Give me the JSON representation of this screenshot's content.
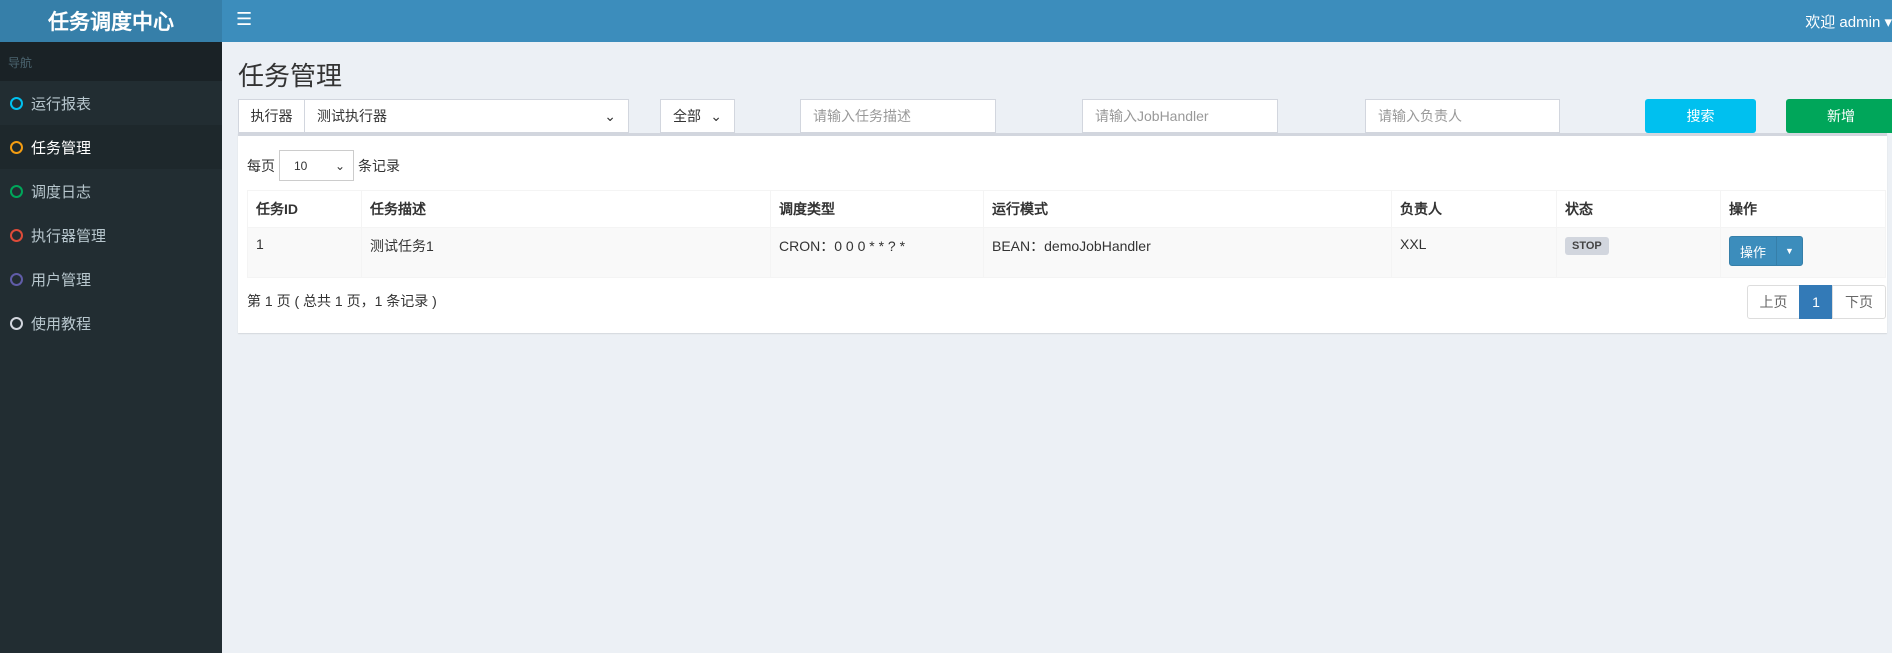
{
  "app": {
    "title": "任务调度中心",
    "welcome": "欢迎 admin"
  },
  "sidebar": {
    "header": "导航",
    "items": [
      {
        "label": "运行报表",
        "color": "#00c0ef"
      },
      {
        "label": "任务管理",
        "color": "#f39c12"
      },
      {
        "label": "调度日志",
        "color": "#00a65a"
      },
      {
        "label": "执行器管理",
        "color": "#dd4b39"
      },
      {
        "label": "用户管理",
        "color": "#605ca8"
      },
      {
        "label": "使用教程",
        "color": "#d2d6de"
      }
    ]
  },
  "page": {
    "title": "任务管理"
  },
  "filters": {
    "executor_label": "执行器",
    "executor_value": "测试执行器",
    "status_value": "全部",
    "desc_placeholder": "请输入任务描述",
    "handler_placeholder": "请输入JobHandler",
    "author_placeholder": "请输入负责人",
    "search": "搜索",
    "add": "新增"
  },
  "table": {
    "per_page_prefix": "每页",
    "per_page_value": "10",
    "per_page_suffix": "条记录",
    "headers": [
      "任务ID",
      "任务描述",
      "调度类型",
      "运行模式",
      "负责人",
      "状态",
      "操作"
    ],
    "rows": [
      {
        "id": "1",
        "desc": "测试任务1",
        "schedule": "CRON：0 0 0 * * ? *",
        "mode": "BEAN：demoJobHandler",
        "author": "XXL",
        "status": "STOP",
        "action": "操作"
      }
    ]
  },
  "pagination": {
    "info": "第 1 页 ( 总共 1 页，1 条记录 )",
    "prev": "上页",
    "current": "1",
    "next": "下页"
  }
}
